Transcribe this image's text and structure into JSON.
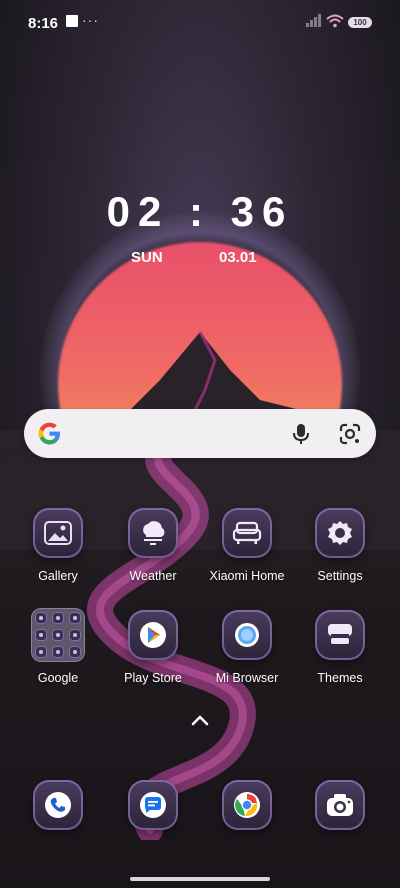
{
  "status_bar": {
    "time": "8:16",
    "battery": "100",
    "icons": [
      "notification-square-icon",
      "more-dots-icon",
      "signal-icon",
      "wifi-icon",
      "battery-icon"
    ]
  },
  "clock": {
    "time": "02 : 36",
    "day": "SUN",
    "date": "03.01"
  },
  "search_bar": {
    "icons": [
      "google-logo-icon",
      "microphone-icon",
      "google-lens-icon"
    ]
  },
  "apps_row1": [
    {
      "label": "Gallery",
      "icon": "gallery-icon"
    },
    {
      "label": "Weather",
      "icon": "weather-icon"
    },
    {
      "label": "Xiaomi Home",
      "icon": "xiaomi-home-icon"
    },
    {
      "label": "Settings",
      "icon": "settings-gear-icon"
    }
  ],
  "apps_row2": [
    {
      "label": "Google",
      "icon": "google-folder-icon"
    },
    {
      "label": "Play Store",
      "icon": "play-store-icon"
    },
    {
      "label": "Mi Browser",
      "icon": "browser-icon"
    },
    {
      "label": "Themes",
      "icon": "themes-icon"
    }
  ],
  "dock": [
    {
      "icon": "phone-icon"
    },
    {
      "icon": "messages-icon"
    },
    {
      "icon": "chrome-icon"
    },
    {
      "icon": "camera-icon"
    }
  ],
  "colors": {
    "sun_top": "#e8506a",
    "sun_bottom": "#f29a54",
    "tile_outline": "#aa8cdc",
    "stream": "#c84aa8"
  }
}
